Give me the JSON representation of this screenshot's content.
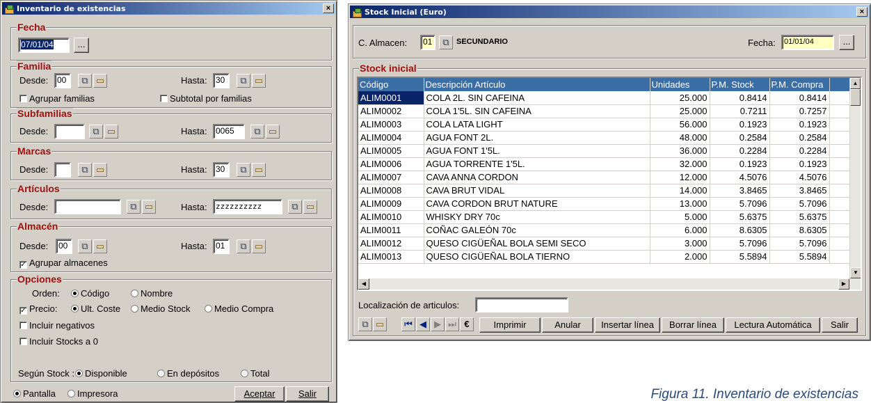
{
  "left": {
    "title": "Inventario de existencias",
    "fecha": {
      "label": "Fecha",
      "value": "07/01/04",
      "btn": "..."
    },
    "familia": {
      "label": "Familia",
      "desde_label": "Desde:",
      "desde": "00",
      "hasta_label": "Hasta:",
      "hasta": "30",
      "agrupar": "Agrupar familias",
      "subtotal": "Subtotal por familias"
    },
    "subfamilias": {
      "label": "Subfamilias",
      "desde_label": "Desde:",
      "desde": "",
      "hasta_label": "Hasta:",
      "hasta": "0065"
    },
    "marcas": {
      "label": "Marcas",
      "desde_label": "Desde:",
      "desde": "",
      "hasta_label": "Hasta:",
      "hasta": "30"
    },
    "articulos": {
      "label": "Artículos",
      "desde_label": "Desde:",
      "desde": "",
      "hasta_label": "Hasta:",
      "hasta": "zzzzzzzzzz"
    },
    "almacen": {
      "label": "Almacén",
      "desde_label": "Desde:",
      "desde": "00",
      "hasta_label": "Hasta:",
      "hasta": "01",
      "agrupar": "Agrupar almacenes"
    },
    "opciones": {
      "label": "Opciones",
      "orden_label": "Orden:",
      "orden_codigo": "Código",
      "orden_nombre": "Nombre",
      "precio_label": "Precio:",
      "ult_coste": "Ult. Coste",
      "medio_stock": "Medio Stock",
      "medio_compra": "Medio Compra",
      "incluir_negativos": "Incluir negativos",
      "incluir_stocks": "Incluir Stocks a 0",
      "segun_label": "Según Stock :",
      "disponible": "Disponible",
      "en_depositos": "En depósitos",
      "total": "Total"
    },
    "pantalla": "Pantalla",
    "impresora": "Impresora",
    "aceptar": "Aceptar",
    "salir": "Salir"
  },
  "right": {
    "title": "Stock Inicial (Euro)",
    "almacen_label": "C. Almacen:",
    "almacen_value": "01",
    "almacen_name": "SECUNDARIO",
    "fecha_label": "Fecha:",
    "fecha_value": "01/01/04",
    "btn": "...",
    "group_label": "Stock inicial",
    "columns": [
      "Código",
      "Descripción Artículo",
      "Unidades",
      "P.M. Stock",
      "P.M. Compra"
    ],
    "rows": [
      [
        "ALIM0001",
        "COLA 2L. SIN CAFEINA",
        "25.000",
        "0.8414",
        "0.8414"
      ],
      [
        "ALIM0002",
        "COLA 1'5L. SIN CAFEINA",
        "25.000",
        "0.7211",
        "0.7257"
      ],
      [
        "ALIM0003",
        "COLA LATA LIGHT",
        "56.000",
        "0.1923",
        "0.1923"
      ],
      [
        "ALIM0004",
        "AGUA FONT  2L.",
        "48.000",
        "0.2584",
        "0.2584"
      ],
      [
        "ALIM0005",
        "AGUA FONT  1'5L.",
        "36.000",
        "0.2284",
        "0.2284"
      ],
      [
        "ALIM0006",
        "AGUA TORRENTE 1'5L.",
        "32.000",
        "0.1923",
        "0.1923"
      ],
      [
        "ALIM0007",
        "CAVA ANNA CORDON",
        "12.000",
        "4.5076",
        "4.5076"
      ],
      [
        "ALIM0008",
        "CAVA BRUT VIDAL",
        "14.000",
        "3.8465",
        "3.8465"
      ],
      [
        "ALIM0009",
        "CAVA CORDON BRUT NATURE",
        "13.000",
        "5.7096",
        "5.7096"
      ],
      [
        "ALIM0010",
        "WHISKY DRY 70c",
        "5.000",
        "5.6375",
        "5.6375"
      ],
      [
        "ALIM0011",
        "COÑAC GALEÓN 70c",
        "6.000",
        "8.6305",
        "8.6305"
      ],
      [
        "ALIM0012",
        "QUESO CIGÜEÑAL BOLA SEMI SECO",
        "3.000",
        "5.7096",
        "5.7096"
      ],
      [
        "ALIM0013",
        "QUESO CIGÜEÑAL BOLA TIERNO",
        "2.000",
        "5.5894",
        "5.5894"
      ]
    ],
    "localizacion_label": "Localización de articulos:",
    "toolbar": {
      "euro": "€",
      "imprimir": "Imprimir",
      "anular": "Anular",
      "insertar": "Insertar línea",
      "borrar": "Borrar línea",
      "lectura": "Lectura Automática",
      "salir": "Salir"
    }
  },
  "caption": "Figura 11. Inventario de existencias"
}
